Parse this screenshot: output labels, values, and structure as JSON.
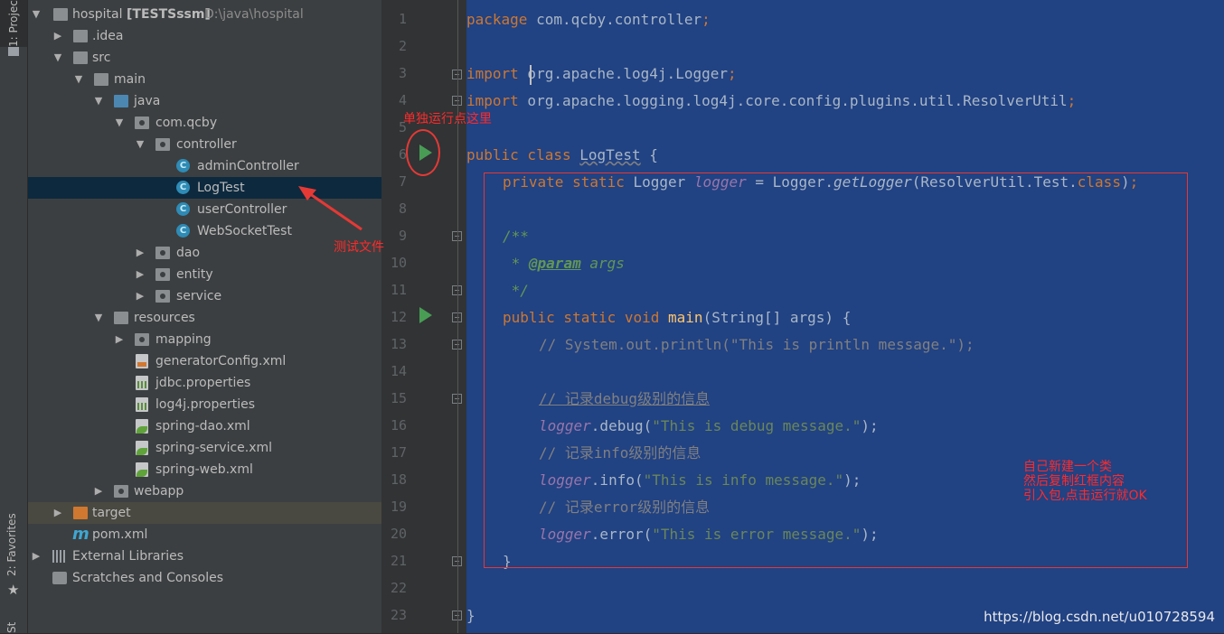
{
  "left_strip": {
    "project_tab": "1: Project",
    "favorites_tab": "2: Favorites",
    "structure_tab": "Structure"
  },
  "tree": {
    "root": {
      "name": "hospital",
      "module": "[TESTSssm]",
      "path": "D:\\java\\hospital"
    },
    "items": [
      {
        "label": ".idea"
      },
      {
        "label": "src"
      },
      {
        "label": "main"
      },
      {
        "label": "java"
      },
      {
        "label": "com.qcby"
      },
      {
        "label": "controller"
      },
      {
        "label": "adminController"
      },
      {
        "label": "LogTest"
      },
      {
        "label": "userController"
      },
      {
        "label": "WebSocketTest"
      },
      {
        "label": "dao"
      },
      {
        "label": "entity"
      },
      {
        "label": "service"
      },
      {
        "label": "resources"
      },
      {
        "label": "mapping"
      },
      {
        "label": "generatorConfig.xml"
      },
      {
        "label": "jdbc.properties"
      },
      {
        "label": "log4j.properties"
      },
      {
        "label": "spring-dao.xml"
      },
      {
        "label": "spring-service.xml"
      },
      {
        "label": "spring-web.xml"
      },
      {
        "label": "webapp"
      },
      {
        "label": "target"
      },
      {
        "label": "pom.xml"
      },
      {
        "label": "External Libraries"
      },
      {
        "label": "Scratches and Consoles"
      }
    ],
    "class_icon_letter": "C",
    "maven_icon_letter": "m"
  },
  "gutter": {
    "line_numbers": [
      "1",
      "2",
      "3",
      "4",
      "5",
      "6",
      "7",
      "8",
      "9",
      "10",
      "11",
      "12",
      "13",
      "14",
      "15",
      "16",
      "17",
      "18",
      "19",
      "20",
      "21",
      "22",
      "23"
    ]
  },
  "code": {
    "l1_kw": "package",
    "l1_rest": " com.qcby.controller",
    "semi": ";",
    "l3_kw": "import",
    "l3_rest": " org.apache.log4j.Logger",
    "l4_kw": "import",
    "l4_rest": " org.apache.logging.log4j.core.config.plugins.util.ResolverUtil",
    "l6_kw": "public class",
    "l6_name": "LogTest",
    "l6_brace": " {",
    "l7_kw": "private static",
    "l7_type": " Logger ",
    "l7_field": "logger",
    "l7_eq": " = Logger.",
    "l7_method": "getLogger",
    "l7_args": "(ResolverUtil.Test.",
    "l7_class": "class",
    "l7_end": ")",
    "l9_doc": "/**",
    "l10_star": " * ",
    "l10_tag": "@param",
    "l10_name": " args",
    "l11_doc": " */",
    "l12_kw": "public static void",
    "l12_method": " main",
    "l12_args": "(String[] args) {",
    "l13_comment": "// System.out.println(\"This is println message.\");",
    "l15_comment": "// 记录debug级别的信息",
    "l16_field": "logger",
    "l16_call": ".debug(",
    "l16_str": "\"This is debug message.\"",
    "l16_end": ");",
    "l17_comment": "// 记录info级别的信息",
    "l18_field": "logger",
    "l18_call": ".info(",
    "l18_str": "\"This is info message.\"",
    "l18_end": ");",
    "l19_comment": "// 记录error级别的信息",
    "l20_field": "logger",
    "l20_call": ".error(",
    "l20_str": "\"This is error message.\"",
    "l20_end": ");",
    "l21_brace": "}",
    "l23_brace": "}"
  },
  "annotations": {
    "run_here": "单独运行点这里",
    "test_file": "测试文件",
    "right_line1": "自己新建一个类",
    "right_line2": "然后复制红框内容",
    "right_line3": "引入包,点击运行就OK"
  },
  "watermark": "https://blog.csdn.net/u010728594",
  "colors": {
    "editor_selection": "#214283",
    "annotation_red": "#e53935",
    "run_green": "#499c54"
  }
}
